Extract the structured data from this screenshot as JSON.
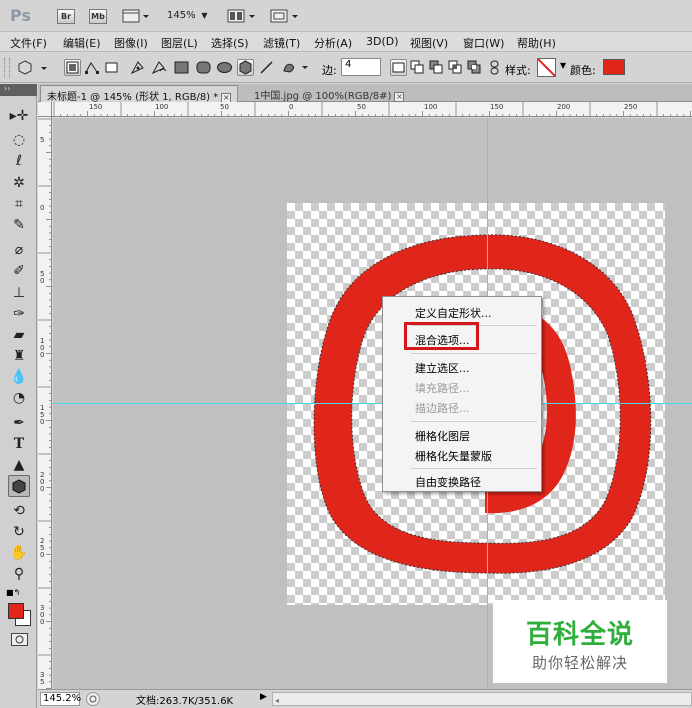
{
  "app": {
    "logo": "Ps",
    "bridge_btn": "Br",
    "minibridge_btn": "Mb",
    "zoom_value": "145%"
  },
  "menu": [
    "文件(F)",
    "编辑(E)",
    "图像(I)",
    "图层(L)",
    "选择(S)",
    "滤镜(T)",
    "分析(A)",
    "3D(D)",
    "视图(V)",
    "窗口(W)",
    "帮助(H)"
  ],
  "options": {
    "edge_label": "边:",
    "edge_value": "4",
    "style_label": "样式:",
    "color_label": "颜色:",
    "color": "#e0251b"
  },
  "tabs": [
    {
      "label": "未标题-1 @ 145% (形状 1, RGB/8) *",
      "active": true
    },
    {
      "label": "1中国.jpg @ 100%(RGB/8#)",
      "active": false
    }
  ],
  "ruler_top_labels": [
    "150",
    "100",
    "50",
    "0",
    "50",
    "100",
    "150",
    "200",
    "250"
  ],
  "ruler_left_labels": [
    "5",
    "0",
    "5 0",
    "1 0 0",
    "1 5 0",
    "2 0 0",
    "2 5 0",
    "3 0 0",
    "3 5"
  ],
  "context_menu": {
    "items": [
      {
        "label": "定义自定形状...",
        "disabled": false
      },
      {
        "label": "混合选项...",
        "disabled": false
      },
      {
        "label": "建立选区...",
        "disabled": false
      },
      {
        "label": "填充路径...",
        "disabled": true
      },
      {
        "label": "描边路径...",
        "disabled": true
      },
      {
        "label": "栅格化图层",
        "disabled": false
      },
      {
        "label": "栅格化矢量蒙版",
        "disabled": false
      },
      {
        "label": "自由变换路径",
        "disabled": false
      }
    ]
  },
  "watermark": {
    "title": "百科全说",
    "subtitle": "助你轻松解决"
  },
  "status": {
    "zoom": "145.2%",
    "doc_info": "文档:263.7K/351.6K"
  },
  "colors": {
    "shape_red": "#e0251b",
    "guide": "#46d9e6",
    "highlight": "#d4161c",
    "watermark_green": "#2fae3b"
  }
}
